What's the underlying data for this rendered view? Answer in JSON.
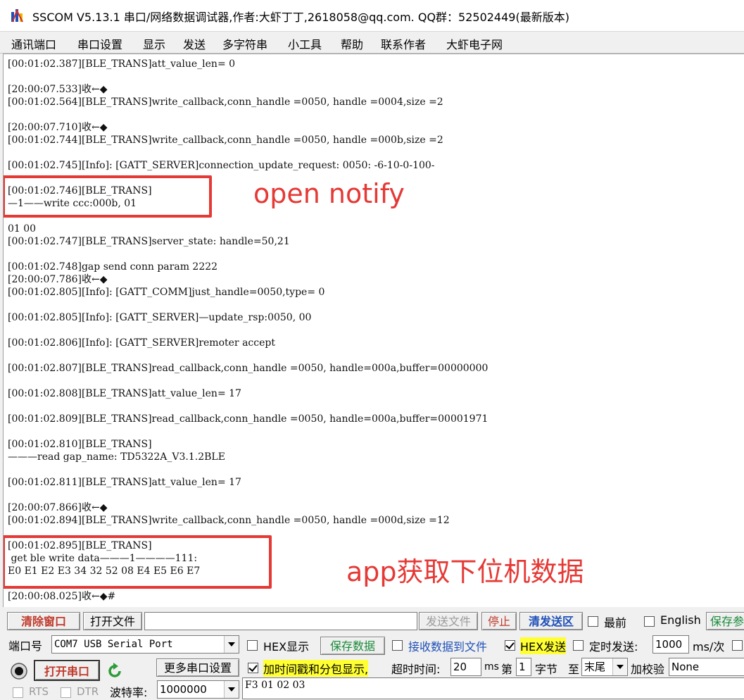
{
  "window": {
    "title": "SSCOM V5.13.1 串口/网络数据调试器,作者:大虾丁丁,2618058@qq.com. QQ群：52502449(最新版本)"
  },
  "menu": {
    "items": [
      "通讯端口",
      "串口设置",
      "显示",
      "发送",
      "多字符串",
      "小工具",
      "帮助",
      "联系作者",
      "大虾电子网"
    ]
  },
  "console": {
    "lines": [
      "[00:01:02.387][BLE_TRANS]att_value_len= 0",
      "[20:00:07.533]收←◆",
      "[00:01:02.564][BLE_TRANS]write_callback,conn_handle =0050, handle =0004,size =2",
      "[20:00:07.710]收←◆",
      "[00:01:02.744][BLE_TRANS]write_callback,conn_handle =0050, handle =000b,size =2",
      "[00:01:02.745][Info]: [GATT_SERVER]connection_update_request: 0050: -6-10-0-100-",
      "[00:01:02.746][BLE_TRANS]",
      "—1——write ccc:000b, 01",
      "01 00",
      "[00:01:02.747][BLE_TRANS]server_state: handle=50,21",
      "[00:01:02.748]gap send conn param 2222",
      "[20:00:07.786]收←◆",
      "[00:01:02.805][Info]: [GATT_COMM]just_handle=0050,type= 0",
      "[00:01:02.805][Info]: [GATT_SERVER]—update_rsp:0050, 00",
      "[00:01:02.806][Info]: [GATT_SERVER]remoter accept",
      "[00:01:02.807][BLE_TRANS]read_callback,conn_handle =0050, handle=000a,buffer=00000000",
      "[00:01:02.808][BLE_TRANS]att_value_len= 17",
      "[00:01:02.809][BLE_TRANS]read_callback,conn_handle =0050, handle=000a,buffer=00001971",
      "[00:01:02.810][BLE_TRANS]",
      "———read gap_name: TD5322A_V3.1.2BLE",
      "[00:01:02.811][BLE_TRANS]att_value_len= 17",
      "[20:00:07.866]收←◆",
      "[00:01:02.894][BLE_TRANS]write_callback,conn_handle =0050, handle =000d,size =12",
      "[00:01:02.895][BLE_TRANS]",
      " get ble write data———1————111:",
      "E0 E1 E2 E3 34 32 52 08 E4 E5 E6 E7",
      "[20:00:08.025]收←◆#"
    ]
  },
  "annotations": {
    "open_notify": "open notify",
    "app_read": "app获取下位机数据",
    "color": "#e53935"
  },
  "toolbar": {
    "clear_window": "清除窗口",
    "open_file": "打开文件",
    "send_file": "发送文件",
    "stop": "停止",
    "clear_send": "清发送区",
    "topmost": "最前",
    "english": "English",
    "save_params": "保存参"
  },
  "port": {
    "port_label": "端口号",
    "port_value": "COM7 USB Serial Port",
    "hex_display": "HEX显示",
    "save_data": "保存数据",
    "recv_to_file": "接收数据到文件",
    "hex_send": "HEX发送",
    "timed_send": "定时发送:",
    "interval": "1000",
    "interval_unit": "ms/次"
  },
  "options": {
    "open_port": "打开串口",
    "more_settings": "更多串口设置",
    "timestamp": "加时间戳和分包显示,",
    "timeout_label": "超时时间:",
    "timeout_value": "20",
    "timeout_unit": "ms",
    "nth_label": "第",
    "nth_value": "1",
    "byte_label": "字节",
    "to_label": "至",
    "end_value": "末尾",
    "checksum_label": "加校验",
    "checksum_value": "None"
  },
  "bottom": {
    "rts": "RTS",
    "dtr": "DTR",
    "baud_label": "波特率:",
    "baud_value": "1000000",
    "send_content": "F3 01 02 03"
  }
}
